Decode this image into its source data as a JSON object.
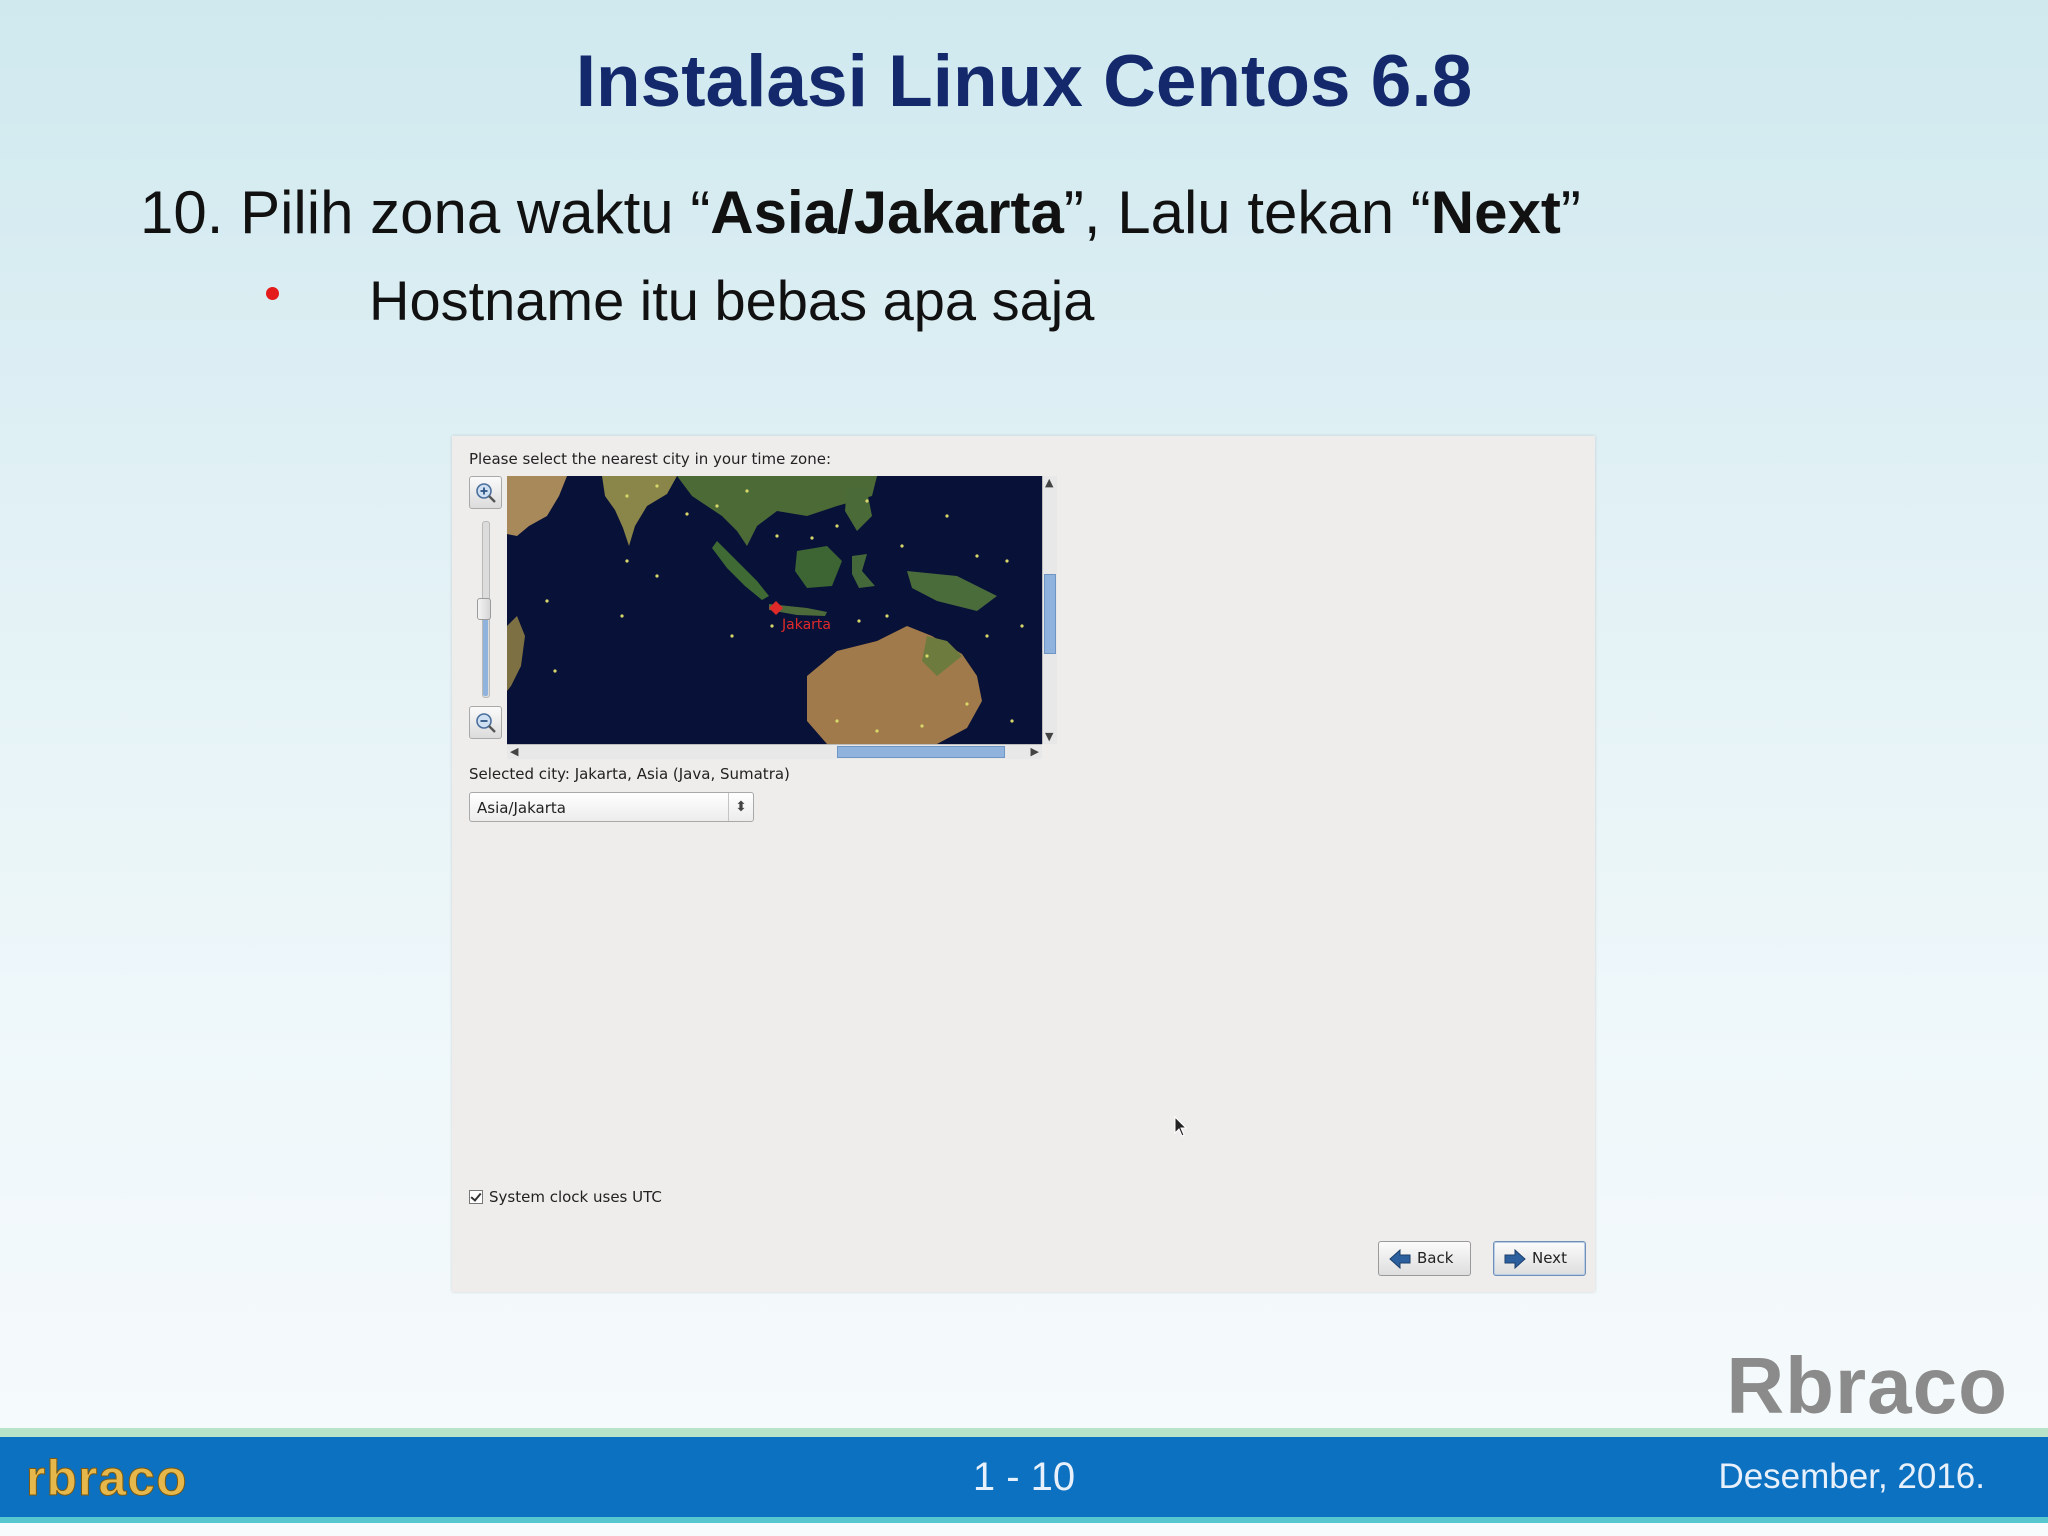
{
  "slide": {
    "title": "Instalasi Linux Centos 6.8",
    "step": {
      "prefix": "10. Pilih zona waktu “",
      "city": "Asia/Jakarta",
      "middle": "”, Lalu tekan “",
      "button": "Next",
      "suffix": "”"
    },
    "bullet": "Hostname itu bebas apa saja",
    "watermark": "Rbraco"
  },
  "installer": {
    "prompt": "Please select the nearest city in your time zone:",
    "map": {
      "marker_label": "Jakarta",
      "zoom_in_icon": "zoom-in-icon",
      "zoom_out_icon": "zoom-out-icon"
    },
    "selected_city": "Selected city: Jakarta, Asia (Java, Sumatra)",
    "timezone_select": {
      "value": "Asia/Jakarta"
    },
    "utc_checkbox": {
      "label": "System clock uses UTC",
      "checked": true
    },
    "buttons": {
      "back": "Back",
      "next": "Next"
    }
  },
  "footer": {
    "logo": "rbraco",
    "page": "1 - 10",
    "date": "Desember, 2016."
  },
  "colors": {
    "title": "#14296b",
    "bullet": "#e41b1b",
    "footer_bar": "#0b71c0",
    "map_ocean": "#081137",
    "accent_scroll": "#8fb3dc"
  }
}
